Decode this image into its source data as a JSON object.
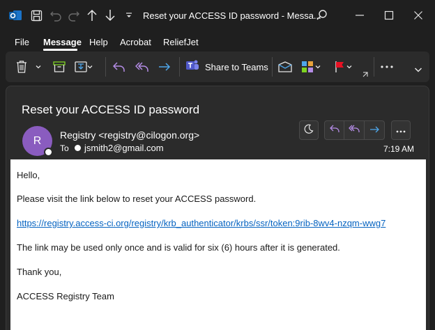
{
  "window": {
    "title": "Reset your ACCESS ID password  -  Messa..."
  },
  "menu": {
    "items": [
      "File",
      "Message",
      "Help",
      "Acrobat",
      "ReliefJet"
    ],
    "active": "Message"
  },
  "ribbon": {
    "share_to_teams": "Share to Teams"
  },
  "message": {
    "subject": "Reset your ACCESS ID password",
    "avatar_initial": "R",
    "sender": "Registry <registry@cilogon.org>",
    "to_label": "To",
    "recipient": "jsmith2@gmail.com",
    "time": "7:19 AM",
    "body": {
      "greeting": "Hello,",
      "line1": "Please visit the link below to reset your ACCESS password.",
      "link": "https://registry.access-ci.org/registry/krb_authenticator/krbs/ssr/token:9rib-8wv4-nzqm-wwg7",
      "line2": "The link may be used only once and is valid for six (6) hours after it is generated.",
      "closing": "Thank you,",
      "signature": "ACCESS Registry Team"
    }
  },
  "colors": {
    "accent_purple": "#b48ce6",
    "accent_blue": "#4ea6ea",
    "avatar": "#8a5cbf",
    "link": "#0563c1",
    "flag_red": "#e81123"
  },
  "icons": [
    "outlook-icon",
    "save-icon",
    "undo-icon",
    "redo-icon",
    "up-arrow-icon",
    "down-arrow-icon",
    "customize-icon",
    "search-icon",
    "minimize-icon",
    "maximize-icon",
    "close-icon",
    "delete-icon",
    "archive-icon",
    "move-icon",
    "reply-icon",
    "reply-all-icon",
    "forward-icon",
    "teams-icon",
    "mark-unread-icon",
    "categorize-icon",
    "flag-icon",
    "more-icon",
    "collapse-icon",
    "dark-mode-icon"
  ]
}
